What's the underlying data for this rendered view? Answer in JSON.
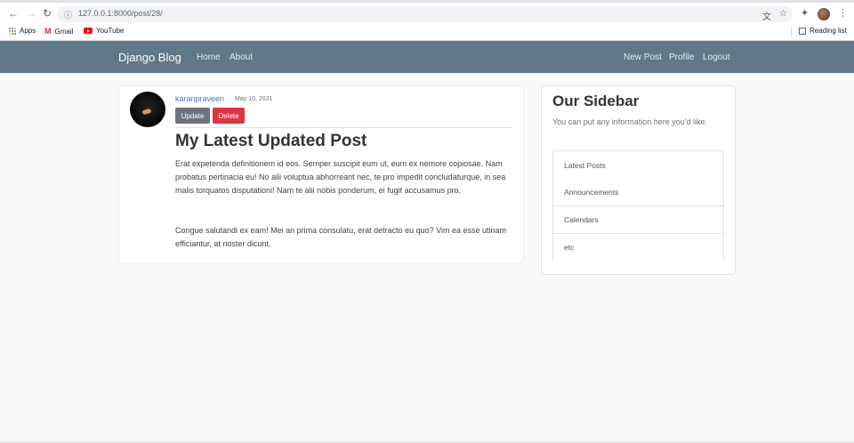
{
  "browser": {
    "url": "127.0.0.1:8000/post/28/",
    "bookmarks": [
      {
        "label": "Apps"
      },
      {
        "label": "Gmail"
      },
      {
        "label": "YouTube"
      }
    ],
    "reading_list_label": "Reading list"
  },
  "site": {
    "brand": "Django Blog",
    "nav_left": [
      "Home",
      "About"
    ],
    "nav_right": [
      "New Post",
      "Profile",
      "Logout"
    ]
  },
  "post": {
    "author": "karanpraveen",
    "date": "May 10, 2021",
    "update_label": "Update",
    "delete_label": "Delete",
    "title": "My Latest Updated Post",
    "paragraphs": [
      "Erat expetenda definitionem id eos. Semper suscipit eum ut, eum ex nemore copiosae. Nam probatus pertinacia eu! No alii voluptua abhorreant nec, te pro impedit concludaturque, in sea malis torquatos disputationi! Nam te alii nobis ponderum, ei fugit accusamus pro.",
      "Congue salutandi ex eam! Mei an prima consulatu, erat detracto eu quo? Vim ea esse utinam efficiantur, at noster dicunt."
    ]
  },
  "sidebar": {
    "title": "Our Sidebar",
    "text": "You can put any information here you'd like.",
    "items": [
      "Latest Posts",
      "Announcements",
      "Calendars",
      "etc"
    ]
  },
  "colors": {
    "navbar": "#5f788a",
    "update_button": "#6c757d",
    "delete_button": "#dc3545",
    "author_link": "#4a7ab5"
  }
}
